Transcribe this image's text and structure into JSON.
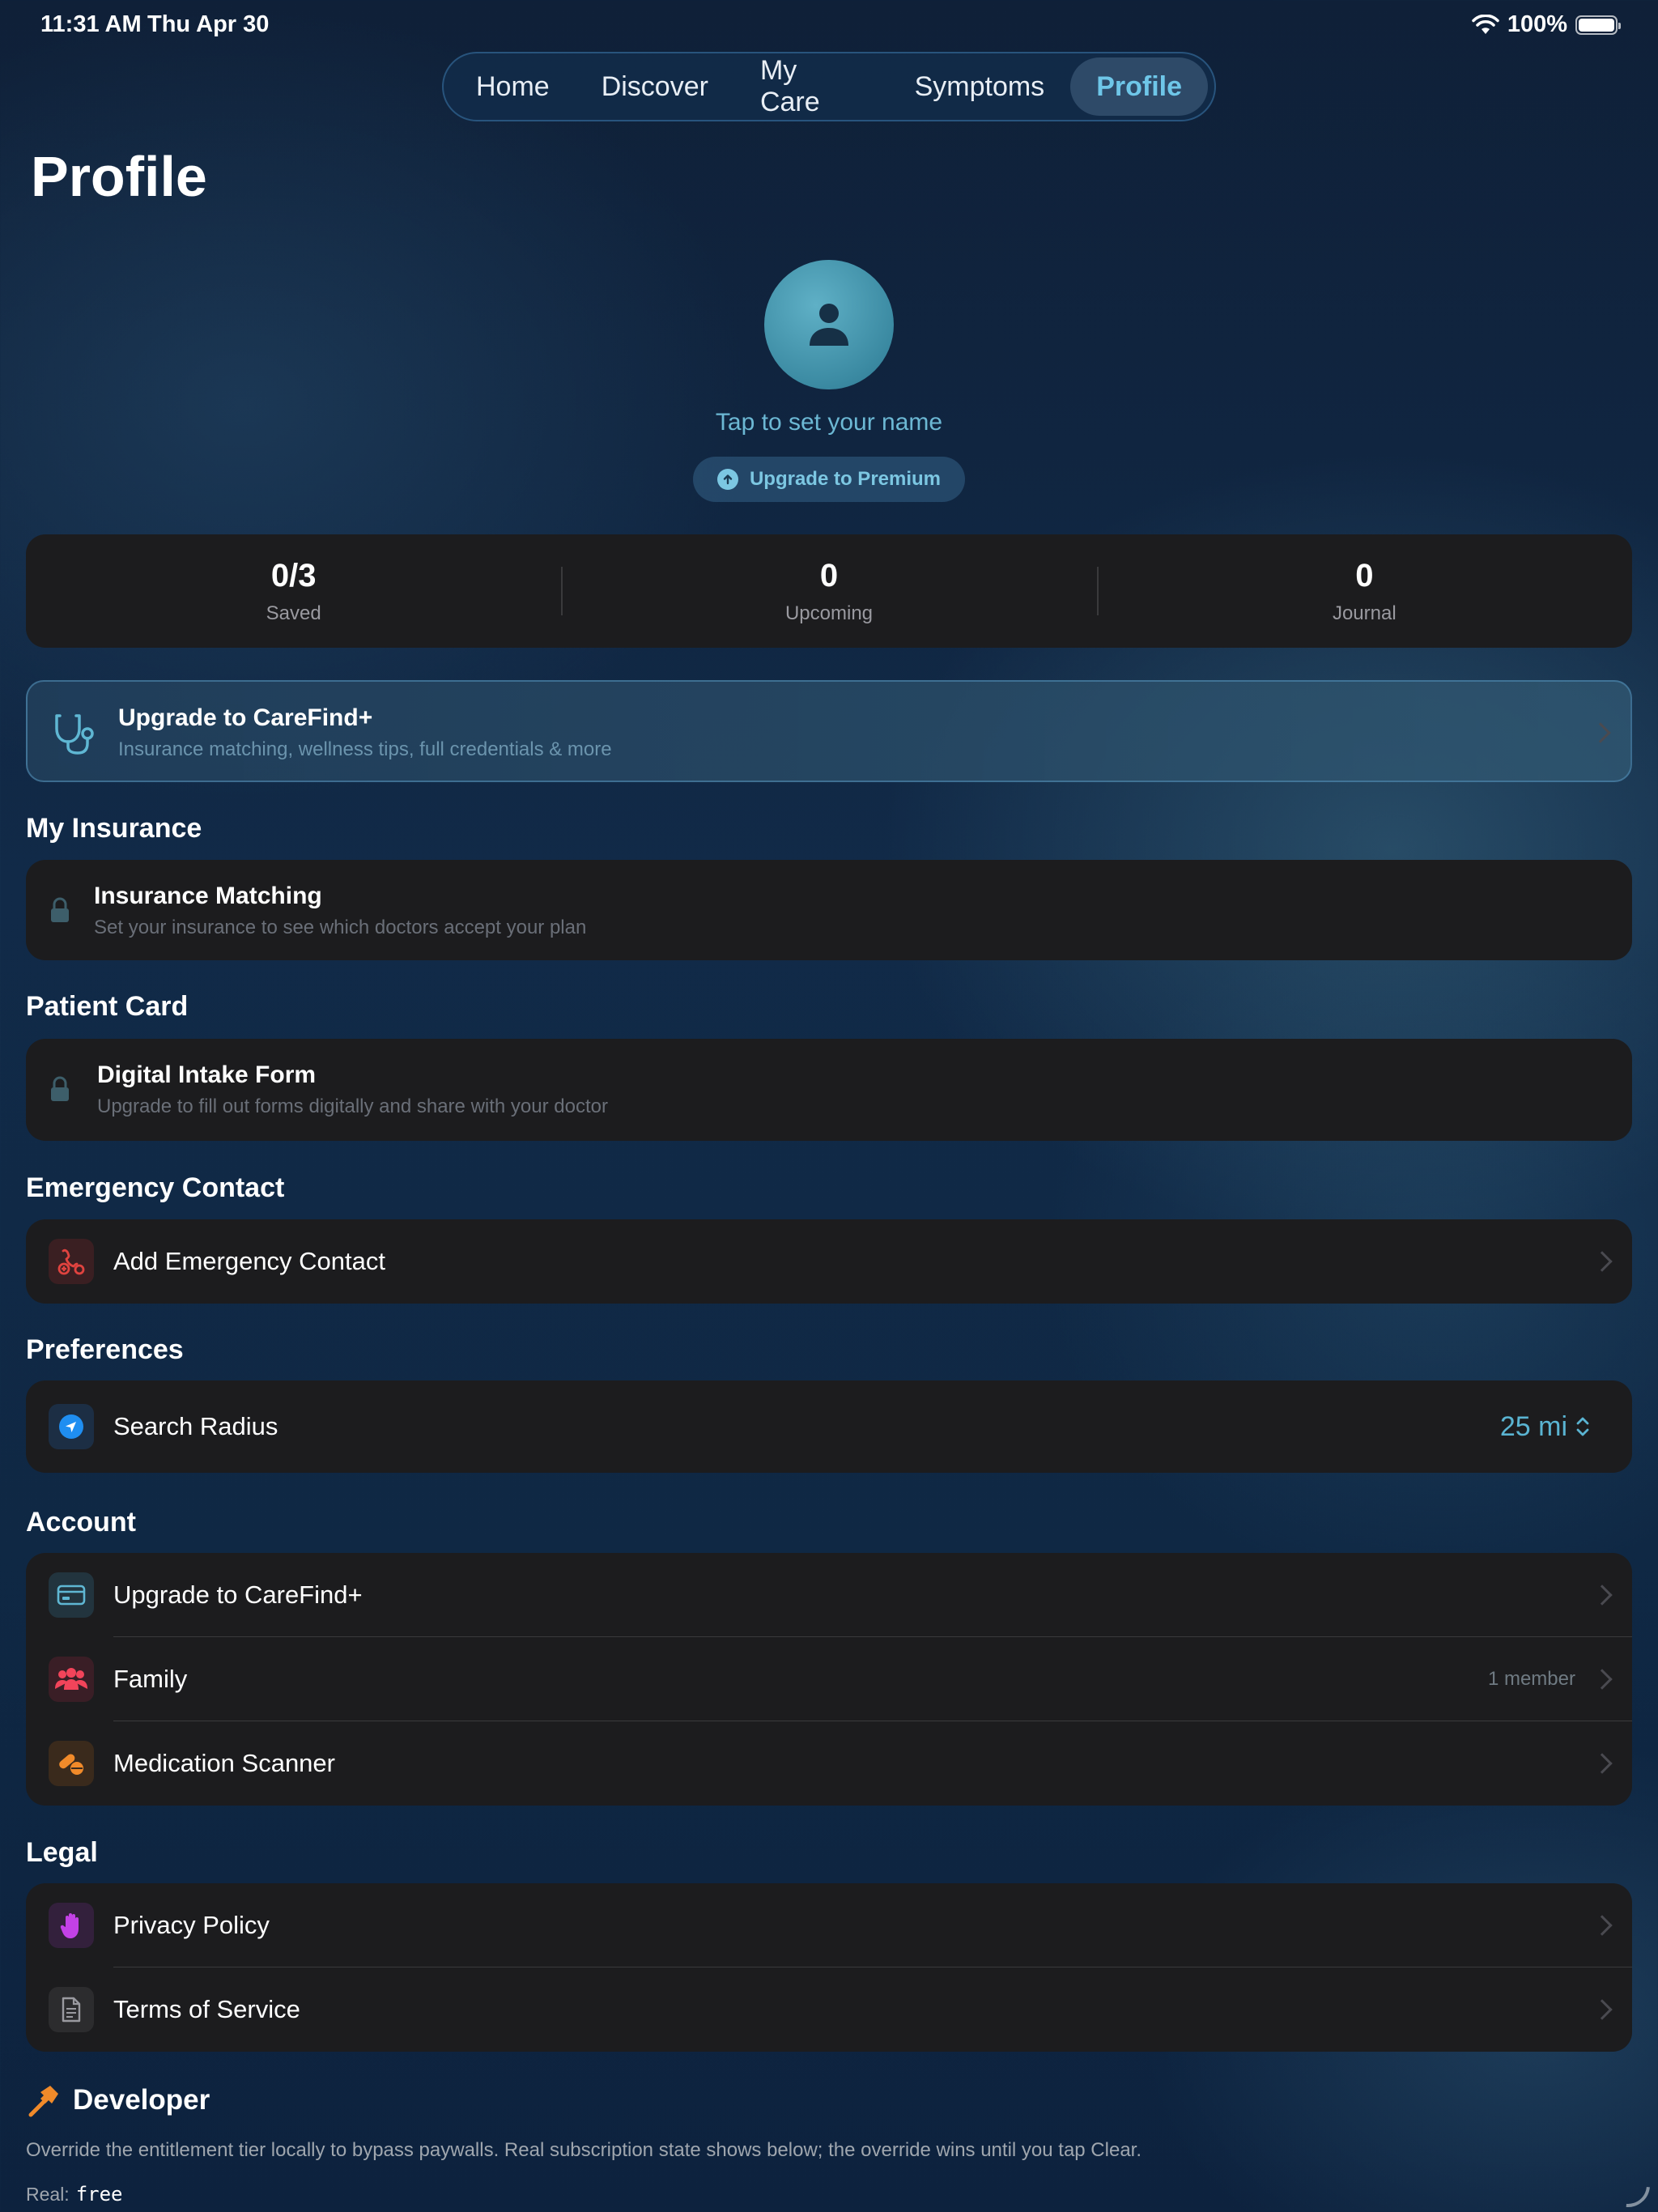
{
  "status": {
    "time": "11:31 AM",
    "date": "Thu Apr 30",
    "battery": "100%"
  },
  "tabs": [
    {
      "label": "Home"
    },
    {
      "label": "Discover"
    },
    {
      "label": "My Care"
    },
    {
      "label": "Symptoms"
    },
    {
      "label": "Profile",
      "active": true
    }
  ],
  "page": {
    "title": "Profile"
  },
  "profile": {
    "name_prompt": "Tap to set your name",
    "premium_label": "Upgrade to Premium"
  },
  "stats": [
    {
      "value": "0/3",
      "label": "Saved"
    },
    {
      "value": "0",
      "label": "Upcoming"
    },
    {
      "value": "0",
      "label": "Journal"
    }
  ],
  "upsell": {
    "title": "Upgrade to CareFind+",
    "subtitle": "Insurance matching, wellness tips, full credentials & more"
  },
  "insurance": {
    "section": "My Insurance",
    "title": "Insurance Matching",
    "subtitle": "Set your insurance to see which doctors accept your plan"
  },
  "patient_card": {
    "section": "Patient Card",
    "title": "Digital Intake Form",
    "subtitle": "Upgrade to fill out forms digitally and share with your doctor"
  },
  "emergency": {
    "section": "Emergency Contact",
    "label": "Add Emergency Contact"
  },
  "preferences": {
    "section": "Preferences",
    "label": "Search Radius",
    "value": "25 mi"
  },
  "account": {
    "section": "Account",
    "items": [
      {
        "label": "Upgrade to CareFind+"
      },
      {
        "label": "Family",
        "detail": "1 member"
      },
      {
        "label": "Medication Scanner"
      }
    ]
  },
  "legal": {
    "section": "Legal",
    "items": [
      {
        "label": "Privacy Policy"
      },
      {
        "label": "Terms of Service"
      }
    ]
  },
  "developer": {
    "title": "Developer",
    "description": "Override the entitlement tier locally to bypass paywalls. Real subscription state shows below; the override wins until you tap Clear.",
    "real_label": "Real:",
    "real_value": "free"
  },
  "colors": {
    "accent": "#6ec6e8",
    "card": "#1c1c1e",
    "emergency": "#e0433f",
    "family": "#f2445a",
    "medication": "#f08a2a",
    "privacy": "#c341e6",
    "navigation": "#1f8ef1"
  }
}
